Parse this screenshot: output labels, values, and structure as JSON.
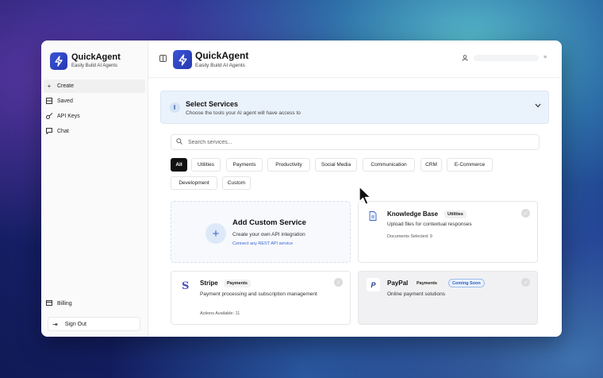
{
  "app": {
    "name": "QuickAgent",
    "tagline": "Easily Build AI Agents",
    "brand_color": "#2d44c4"
  },
  "sidebar": {
    "items": [
      {
        "label": "Create",
        "icon": "plus-icon"
      },
      {
        "label": "Saved",
        "icon": "saved-icon"
      },
      {
        "label": "API Keys",
        "icon": "key-icon"
      },
      {
        "label": "Chat",
        "icon": "chat-icon"
      }
    ],
    "billing": "Billing",
    "sign_out": "Sign Out"
  },
  "services_panel": {
    "title": "Select Services",
    "subtitle": "Choose the tools your AI agent will have access to",
    "search_placeholder": "Search services...",
    "categories": [
      "All",
      "Utilities",
      "Payments",
      "Productivity",
      "Social Media",
      "Communication",
      "CRM",
      "E-Commerce",
      "Development",
      "Custom"
    ],
    "active_category": "All"
  },
  "cards": {
    "custom": {
      "title": "Add Custom Service",
      "subtitle": "Create your own API integration",
      "link": "Connect any REST API service"
    },
    "knowledge_base": {
      "name": "Knowledge Base",
      "badge": "Utilities",
      "desc": "Upload files for contextual responses",
      "meta": "Documents Selected: 9"
    },
    "stripe": {
      "name": "Stripe",
      "badge": "Payments",
      "desc": "Payment processing and subscription management",
      "meta": "Actions Available: 11"
    },
    "paypal": {
      "name": "PayPal",
      "badge": "Payments",
      "status": "Coming Soon",
      "desc": "Online payment solutions"
    }
  }
}
